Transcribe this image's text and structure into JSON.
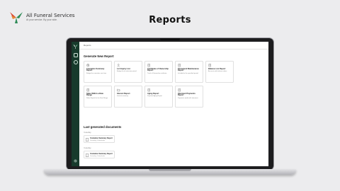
{
  "brand": {
    "name": "All Funeral Services",
    "tagline": "At your service. By your side."
  },
  "page_heading": "Reports",
  "app": {
    "breadcrumb": "Reports",
    "generate_title": "Generate New Report",
    "report_cards": [
      {
        "title": "Cremation Summary Report",
        "desc": "Budget for cremation cost time",
        "icon": "dollar-icon"
      },
      {
        "title": "Lot Inquiry List",
        "desc": "Budget for lot selection period",
        "icon": "person-icon"
      },
      {
        "title": "Certificate of Ownership Report",
        "desc": "Track of Ownership certificate",
        "icon": "document-icon"
      },
      {
        "title": "Permanent Maintenance Report",
        "desc": "Included in the specified period",
        "icon": "document-icon"
      },
      {
        "title": "Balance List Report",
        "desc": "Accounts with balance dates",
        "icon": "document-icon"
      },
      {
        "title": "Sales Within a Date Range",
        "desc": "Sales Report for the Date Range",
        "icon": "document-icon"
      },
      {
        "title": "Interest Report",
        "desc": "Interest summary",
        "icon": "folder-icon"
      },
      {
        "title": "Aging Report",
        "desc": "Payment Aging Report",
        "icon": "document-icon"
      },
      {
        "title": "Interment Payments Report",
        "desc": "Payments made with interment",
        "icon": "document-icon"
      }
    ],
    "last_generated_title": "Last generated documents",
    "doc_groups": [
      {
        "label": "Yesterday",
        "doc_title": "Cremation Summary Report",
        "doc_meta": "Yesterday, 4 downloads"
      },
      {
        "label": "Yesterday",
        "doc_title": "Cremation Summary Report",
        "doc_meta": "Yesterday, 4 downloads"
      }
    ]
  },
  "colors": {
    "sidebar": "#173a2c",
    "accent_green": "#2e8b57",
    "accent_red": "#d9442f"
  }
}
